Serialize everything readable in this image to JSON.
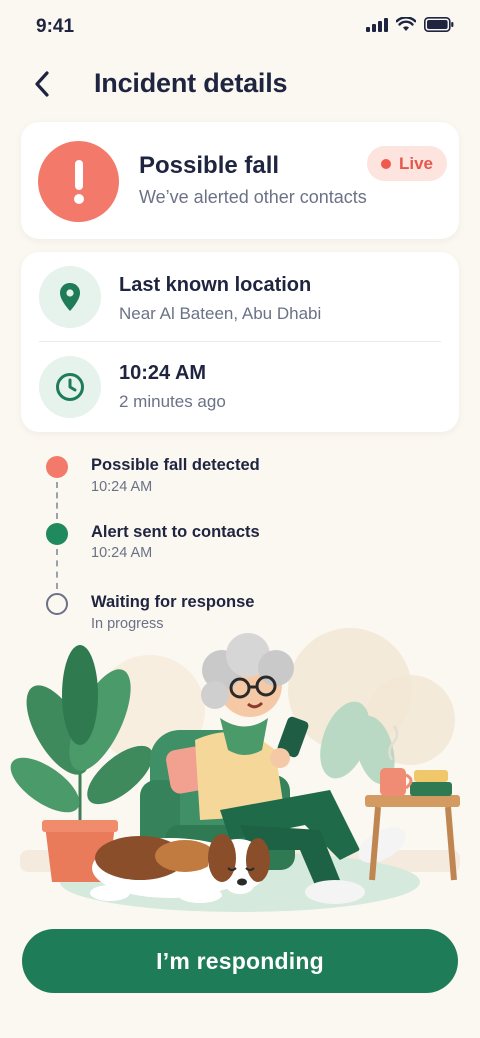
{
  "status_bar": {
    "time": "9:41"
  },
  "header": {
    "title": "Incident details"
  },
  "alert": {
    "title": "Possible fall",
    "subtitle": "We’ve alerted other contacts",
    "badge": "Live"
  },
  "location": {
    "title": "Last known location",
    "subtitle": "Near Al Bateen, Abu Dhabi"
  },
  "time_info": {
    "title": "10:24 AM",
    "subtitle": "2 minutes ago"
  },
  "timeline": [
    {
      "title": "Possible fall detected",
      "subtitle": "10:24 AM",
      "state": "alert"
    },
    {
      "title": "Alert sent to contacts",
      "subtitle": "10:24 AM",
      "state": "done"
    },
    {
      "title": "Waiting for response",
      "subtitle": "In progress",
      "state": "pending"
    }
  ],
  "cta": {
    "label": "I’m responding"
  },
  "colors": {
    "background": "#fbf7f1",
    "alert": "#f3796b",
    "primary": "#1f7c58",
    "live_badge_bg": "#fde4df",
    "live_text": "#e4574b"
  },
  "icons": [
    "back-chevron-icon",
    "exclamation-icon",
    "location-pin-icon",
    "clock-icon",
    "signal-icon",
    "wifi-icon",
    "battery-icon"
  ]
}
